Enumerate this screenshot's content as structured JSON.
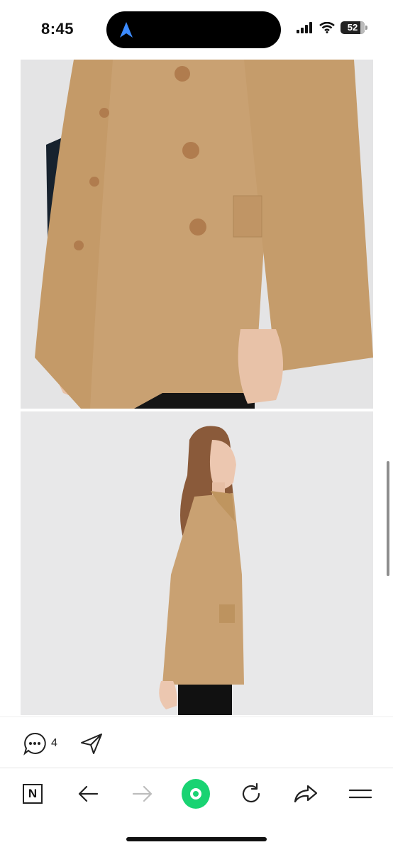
{
  "status_bar": {
    "time": "8:45",
    "battery": "52",
    "icons": [
      "location-arrow-icon",
      "signal-icon",
      "wifi-icon",
      "battery-icon"
    ]
  },
  "images": [
    {
      "name": "camel-cape-coat-closeup",
      "description_icon": "photo"
    },
    {
      "name": "camel-cape-coat-side-view",
      "description_icon": "photo"
    }
  ],
  "comment_bar": {
    "comment_count": "4",
    "icons": [
      "comment-bubble-icon",
      "send-icon"
    ]
  },
  "toolbar": {
    "logo_letter": "N",
    "icons": [
      "naver-logo-icon",
      "back-arrow-icon",
      "forward-arrow-icon",
      "green-circle-icon",
      "reload-icon",
      "share-icon",
      "menu-icon"
    ]
  },
  "colors": {
    "accent_green": "#19d372",
    "coat_camel": "#c9a172",
    "background": "#ffffff"
  }
}
